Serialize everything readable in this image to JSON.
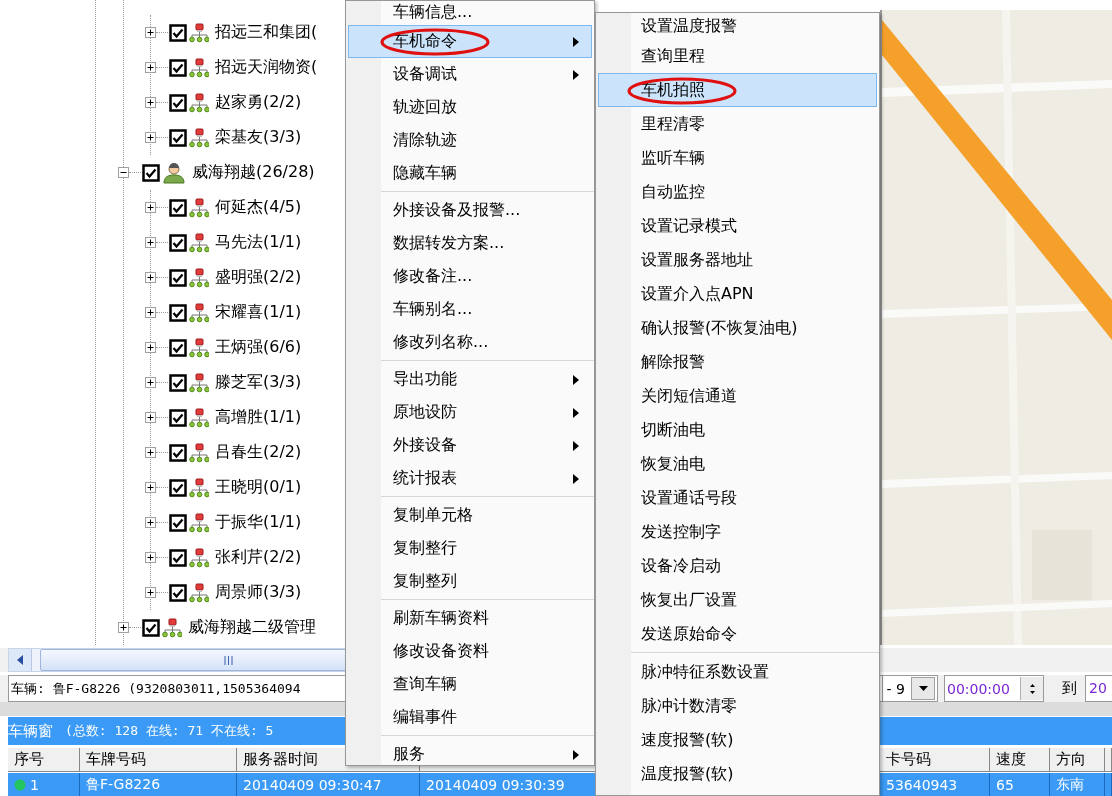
{
  "tree": {
    "nodes": [
      {
        "kind": "continuation",
        "children": [
          {
            "kind": "fleet",
            "label": "招远三和集团(",
            "checked": true,
            "expanded": false
          },
          {
            "kind": "fleet",
            "label": "招远天润物资(",
            "checked": true,
            "expanded": false
          },
          {
            "kind": "fleet",
            "label": "赵家勇(2/2)",
            "checked": true,
            "expanded": false
          },
          {
            "kind": "fleet",
            "label": "栾基友(3/3)",
            "checked": true,
            "expanded": false
          }
        ]
      },
      {
        "kind": "person",
        "label": "威海翔越(26/28)",
        "checked": true,
        "expanded": true,
        "children": [
          {
            "kind": "fleet",
            "label": "何延杰(4/5)",
            "checked": true,
            "expanded": false
          },
          {
            "kind": "fleet",
            "label": "马先法(1/1)",
            "checked": true,
            "expanded": false
          },
          {
            "kind": "fleet",
            "label": "盛明强(2/2)",
            "checked": true,
            "expanded": false
          },
          {
            "kind": "fleet",
            "label": "宋耀喜(1/1)",
            "checked": true,
            "expanded": false
          },
          {
            "kind": "fleet",
            "label": "王炳强(6/6)",
            "checked": true,
            "expanded": false
          },
          {
            "kind": "fleet",
            "label": "滕芝军(3/3)",
            "checked": true,
            "expanded": false
          },
          {
            "kind": "fleet",
            "label": "高增胜(1/1)",
            "checked": true,
            "expanded": false
          },
          {
            "kind": "fleet",
            "label": "吕春生(2/2)",
            "checked": true,
            "expanded": false
          },
          {
            "kind": "fleet",
            "label": "王晓明(0/1)",
            "checked": true,
            "expanded": false
          },
          {
            "kind": "fleet",
            "label": "于振华(1/1)",
            "checked": true,
            "expanded": false
          },
          {
            "kind": "fleet",
            "label": "张利芹(2/2)",
            "checked": true,
            "expanded": false
          },
          {
            "kind": "fleet",
            "label": "周景师(3/3)",
            "checked": true,
            "expanded": false
          }
        ]
      },
      {
        "kind": "fleet",
        "label": "威海翔越二级管理",
        "checked": true,
        "expanded": false
      }
    ]
  },
  "vehicle_info": {
    "text": "车辆: 鲁F-G8226 (9320803011,1505364094"
  },
  "time_filter": {
    "date_value": "- 9",
    "time_value": "00:00:00",
    "to_label": "到",
    "end_value": "20"
  },
  "vehicle_window": {
    "title": "车辆窗",
    "summary": "(总数: 128 在线: 71 不在线: 5",
    "columns": [
      {
        "kind": "label",
        "label": "序号"
      },
      {
        "kind": "label",
        "label": "车牌号码"
      },
      {
        "kind": "label",
        "label": "服务器时间"
      },
      {
        "kind": "covered"
      },
      {
        "kind": "label",
        "label": "卡号码"
      },
      {
        "kind": "label",
        "label": "速度"
      },
      {
        "kind": "label",
        "label": "方向"
      }
    ],
    "rows": [
      {
        "selected": true,
        "online": true,
        "cells": [
          "1",
          "鲁F-G8226",
          "20140409 09:30:47",
          "20140409 09:30:39",
          "53640943",
          "65",
          "东南"
        ]
      }
    ]
  },
  "context_menu": {
    "items": [
      {
        "kind": "item",
        "label": "车辆信息...",
        "highlighted": false,
        "annotated": false,
        "has_submenu": false
      },
      {
        "kind": "item",
        "label": "车机命令",
        "highlighted": true,
        "annotated": true,
        "has_submenu": true
      },
      {
        "kind": "item",
        "label": "设备调试",
        "highlighted": false,
        "annotated": false,
        "has_submenu": true
      },
      {
        "kind": "item",
        "label": "轨迹回放",
        "highlighted": false,
        "annotated": false,
        "has_submenu": false
      },
      {
        "kind": "item",
        "label": "清除轨迹",
        "highlighted": false,
        "annotated": false,
        "has_submenu": false
      },
      {
        "kind": "item",
        "label": "隐藏车辆",
        "highlighted": false,
        "annotated": false,
        "has_submenu": false
      },
      {
        "kind": "separator"
      },
      {
        "kind": "item",
        "label": "外接设备及报警...",
        "highlighted": false,
        "annotated": false,
        "has_submenu": false
      },
      {
        "kind": "item",
        "label": "数据转发方案...",
        "highlighted": false,
        "annotated": false,
        "has_submenu": false
      },
      {
        "kind": "item",
        "label": "修改备注...",
        "highlighted": false,
        "annotated": false,
        "has_submenu": false
      },
      {
        "kind": "item",
        "label": "车辆别名...",
        "highlighted": false,
        "annotated": false,
        "has_submenu": false
      },
      {
        "kind": "item",
        "label": "修改列名称...",
        "highlighted": false,
        "annotated": false,
        "has_submenu": false
      },
      {
        "kind": "separator"
      },
      {
        "kind": "item",
        "label": "导出功能",
        "highlighted": false,
        "annotated": false,
        "has_submenu": true
      },
      {
        "kind": "item",
        "label": "原地设防",
        "highlighted": false,
        "annotated": false,
        "has_submenu": true
      },
      {
        "kind": "item",
        "label": "外接设备",
        "highlighted": false,
        "annotated": false,
        "has_submenu": true
      },
      {
        "kind": "item",
        "label": "统计报表",
        "highlighted": false,
        "annotated": false,
        "has_submenu": true
      },
      {
        "kind": "separator"
      },
      {
        "kind": "item",
        "label": "复制单元格",
        "highlighted": false,
        "annotated": false,
        "has_submenu": false
      },
      {
        "kind": "item",
        "label": "复制整行",
        "highlighted": false,
        "annotated": false,
        "has_submenu": false
      },
      {
        "kind": "item",
        "label": "复制整列",
        "highlighted": false,
        "annotated": false,
        "has_submenu": false
      },
      {
        "kind": "separator"
      },
      {
        "kind": "item",
        "label": "刷新车辆资料",
        "highlighted": false,
        "annotated": false,
        "has_submenu": false
      },
      {
        "kind": "item",
        "label": "修改设备资料",
        "highlighted": false,
        "annotated": false,
        "has_submenu": false
      },
      {
        "kind": "item",
        "label": "查询车辆",
        "highlighted": false,
        "annotated": false,
        "has_submenu": false
      },
      {
        "kind": "item",
        "label": "编辑事件",
        "highlighted": false,
        "annotated": false,
        "has_submenu": false
      },
      {
        "kind": "separator"
      },
      {
        "kind": "item",
        "label": "服务",
        "highlighted": false,
        "annotated": false,
        "has_submenu": true
      }
    ]
  },
  "submenu": {
    "items": [
      {
        "kind": "item",
        "label": "设置温度报警",
        "highlighted": false,
        "annotated": false
      },
      {
        "kind": "item",
        "label": "查询里程",
        "highlighted": false,
        "annotated": false
      },
      {
        "kind": "item",
        "label": "车机拍照",
        "highlighted": true,
        "annotated": true
      },
      {
        "kind": "item",
        "label": "里程清零",
        "highlighted": false,
        "annotated": false
      },
      {
        "kind": "item",
        "label": "监听车辆",
        "highlighted": false,
        "annotated": false
      },
      {
        "kind": "item",
        "label": "自动监控",
        "highlighted": false,
        "annotated": false
      },
      {
        "kind": "item",
        "label": "设置记录模式",
        "highlighted": false,
        "annotated": false
      },
      {
        "kind": "item",
        "label": "设置服务器地址",
        "highlighted": false,
        "annotated": false
      },
      {
        "kind": "item",
        "label": "设置介入点APN",
        "highlighted": false,
        "annotated": false
      },
      {
        "kind": "item",
        "label": "确认报警(不恢复油电)",
        "highlighted": false,
        "annotated": false
      },
      {
        "kind": "item",
        "label": "解除报警",
        "highlighted": false,
        "annotated": false
      },
      {
        "kind": "item",
        "label": "关闭短信通道",
        "highlighted": false,
        "annotated": false
      },
      {
        "kind": "item",
        "label": "切断油电",
        "highlighted": false,
        "annotated": false
      },
      {
        "kind": "item",
        "label": "恢复油电",
        "highlighted": false,
        "annotated": false
      },
      {
        "kind": "item",
        "label": "设置通话号段",
        "highlighted": false,
        "annotated": false
      },
      {
        "kind": "item",
        "label": "发送控制字",
        "highlighted": false,
        "annotated": false
      },
      {
        "kind": "item",
        "label": "设备冷启动",
        "highlighted": false,
        "annotated": false
      },
      {
        "kind": "item",
        "label": "恢复出厂设置",
        "highlighted": false,
        "annotated": false
      },
      {
        "kind": "item",
        "label": "发送原始命令",
        "highlighted": false,
        "annotated": false
      },
      {
        "kind": "separator"
      },
      {
        "kind": "item",
        "label": "脉冲特征系数设置",
        "highlighted": false,
        "annotated": false
      },
      {
        "kind": "item",
        "label": "脉冲计数清零",
        "highlighted": false,
        "annotated": false
      },
      {
        "kind": "item",
        "label": "速度报警(软)",
        "highlighted": false,
        "annotated": false
      },
      {
        "kind": "item",
        "label": "温度报警(软)",
        "highlighted": false,
        "annotated": false
      }
    ]
  }
}
